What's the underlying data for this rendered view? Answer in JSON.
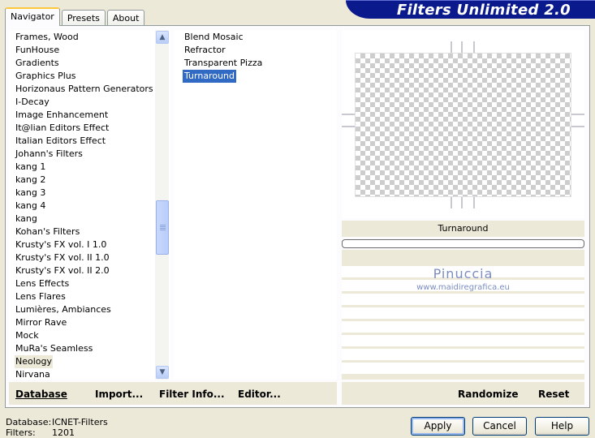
{
  "banner": {
    "title": "Filters Unlimited 2.0"
  },
  "tabs": [
    {
      "label": "Navigator",
      "active": true
    },
    {
      "label": "Presets",
      "active": false
    },
    {
      "label": "About",
      "active": false
    }
  ],
  "categories": {
    "items": [
      "Frames, Wood",
      "FunHouse",
      "Gradients",
      "Graphics Plus",
      "Horizonaus Pattern Generators",
      "I-Decay",
      "Image Enhancement",
      "It@lian Editors Effect",
      "Italian Editors Effect",
      "Johann's Filters",
      "kang 1",
      "kang 2",
      "kang 3",
      "kang 4",
      "kang",
      "Kohan's Filters",
      "Krusty's FX vol. I 1.0",
      "Krusty's FX vol. II 1.0",
      "Krusty's FX vol. II 2.0",
      "Lens Effects",
      "Lens Flares",
      "Lumières, Ambiances",
      "Mirror Rave",
      "Mock",
      "MuRa's Seamless",
      "Neology",
      "Nirvana"
    ],
    "selected": "Neology"
  },
  "filters": {
    "items": [
      "Blend Mosaic",
      "Refractor",
      "Transparent Pizza",
      "Turnaround"
    ],
    "selected": "Turnaround"
  },
  "preview": {
    "filter_name": "Turnaround"
  },
  "watermark": {
    "name": "Pinuccia",
    "site": "www.maidiregrafica.eu"
  },
  "actions": {
    "database": "Database",
    "import": "Import...",
    "filter_info": "Filter Info...",
    "editor": "Editor...",
    "randomize": "Randomize",
    "reset": "Reset"
  },
  "footer": {
    "database_label": "Database:",
    "database_value": "ICNET-Filters",
    "filters_label": "Filters:",
    "filters_value": "1201"
  },
  "buttons": {
    "apply": "Apply",
    "cancel": "Cancel",
    "help": "Help"
  },
  "scrollbar": {
    "position_fraction": 0.6
  }
}
